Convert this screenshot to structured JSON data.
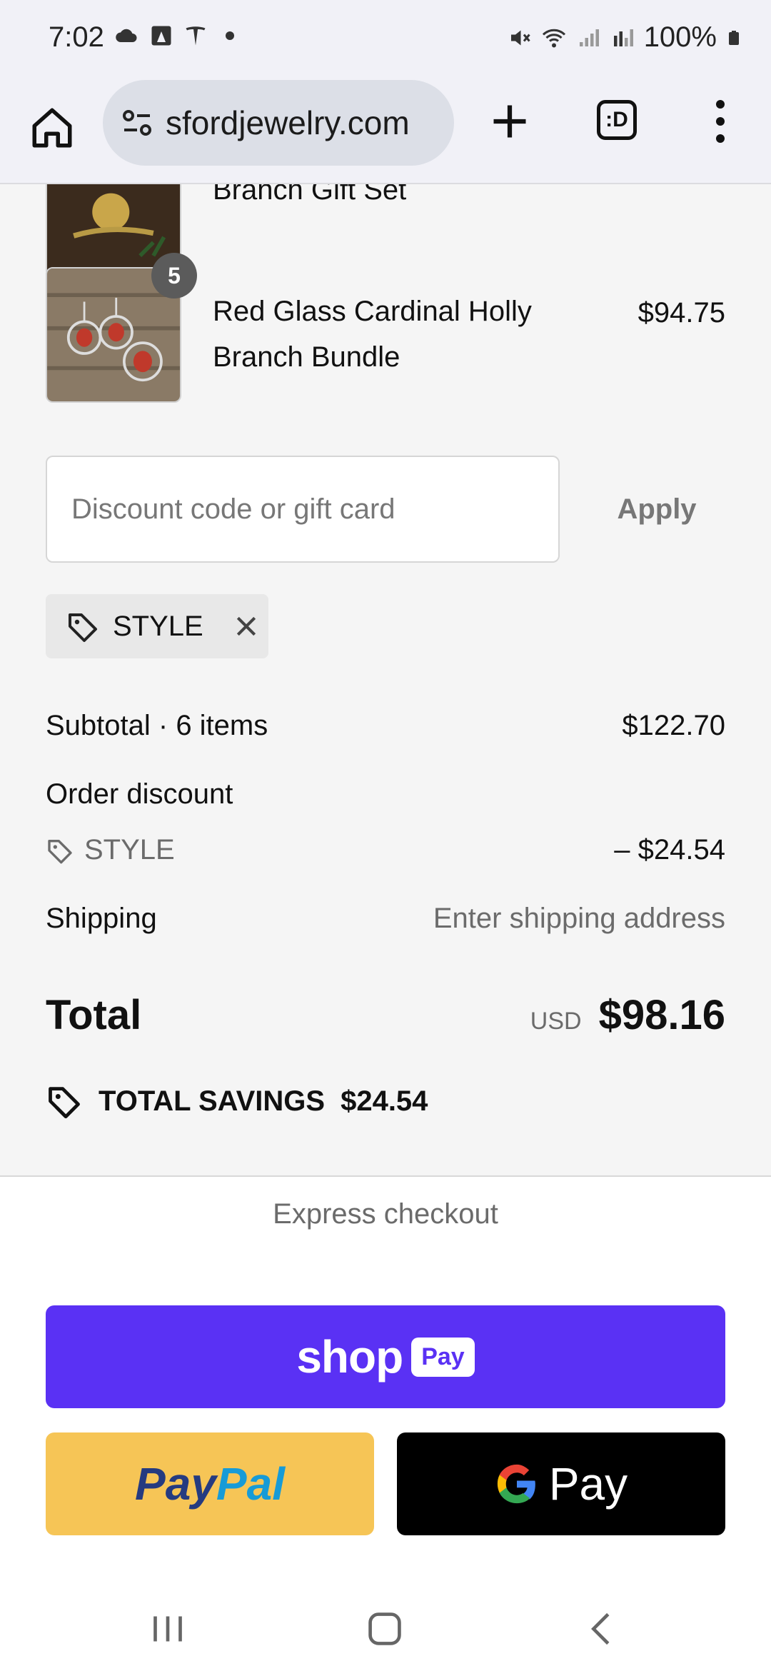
{
  "status_bar": {
    "time": "7:02",
    "battery": "100%"
  },
  "browser": {
    "url": "sfordjewelry.com",
    "tabs_label": ":D"
  },
  "items": [
    {
      "name": "Branch Gift Set"
    },
    {
      "name_line1": "Red Glass Cardinal Holly",
      "name_line2": "Branch Bundle",
      "price": "$94.75",
      "quantity": "5"
    }
  ],
  "discount": {
    "placeholder": "Discount code or gift card",
    "apply_label": "Apply",
    "applied_code": "STYLE"
  },
  "summary": {
    "subtotal_label": "Subtotal · 6 items",
    "subtotal_value": "$122.70",
    "order_discount_label": "Order discount",
    "discount_code": "STYLE",
    "discount_value": "– $24.54",
    "shipping_label": "Shipping",
    "shipping_value": "Enter shipping address",
    "total_label": "Total",
    "currency": "USD",
    "total_value": "$98.16",
    "savings_label": "TOTAL SAVINGS",
    "savings_value": "$24.54"
  },
  "express": {
    "title": "Express checkout",
    "shoppay_word": "shop",
    "shoppay_pay": "Pay",
    "paypal_part1": "Pay",
    "paypal_part2": "Pal",
    "gpay_text": "Pay"
  },
  "colors": {
    "shoppay": "#5a31f4",
    "paypal": "#f6c556",
    "gpay": "#000000"
  }
}
